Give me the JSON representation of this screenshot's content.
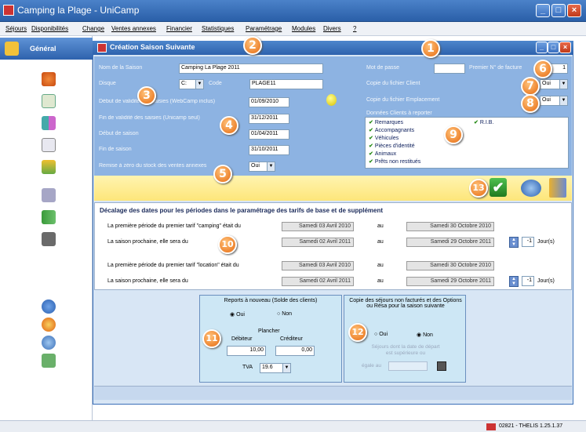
{
  "window": {
    "title": "Camping la Plage - UniCamp"
  },
  "menu": [
    "Séjours",
    "Disponibilités",
    "Change",
    "Ventes annexes",
    "Financier",
    "Statistiques",
    "Paramétrage",
    "Modules",
    "Divers",
    "?"
  ],
  "sidebar": {
    "head": "Général"
  },
  "dialog": {
    "title": "Création Saison Suivante"
  },
  "form": {
    "nom_label": "Nom de la Saison",
    "nom_value": "Camping La Plage 2011",
    "disque_label": "Disque",
    "disque_value": "C:",
    "code_label": "Code",
    "code_value": "PLAGE11",
    "debut_ventes_label": "Début de validité des saisies (WebCamp inclus)",
    "debut_ventes_value": "01/09/2010",
    "fin_ventes_label": "Fin de validité des saisies (Unicamp seul)",
    "fin_ventes_value": "31/12/2011",
    "debut_saison_label": "Début de saison",
    "debut_saison_value": "01/04/2011",
    "fin_saison_label": "Fin de saison",
    "fin_saison_value": "31/10/2011",
    "stock_label": "Remise à zéro du stock des ventes annexes",
    "stock_value": "Oui",
    "mdp_label": "Mot de passe",
    "facture_label": "Premier N° de facture",
    "facture_value": "1",
    "copie_client_label": "Copie du fichier Client",
    "copie_client_value": "Oui",
    "copie_emp_label": "Copie du fichier Emplacement",
    "copie_emp_value": "Oui",
    "donnees_label": "Données Clients à reporter"
  },
  "checks_left": [
    "Remarques",
    "Accompagnants",
    "Véhicules",
    "Pièces d'identité",
    "Animaux",
    "Prêts non restitués"
  ],
  "checks_right": [
    "R.I.B."
  ],
  "decalage": {
    "title": "Décalage des dates pour les périodes dans le paramétrage des tarifs de base et de supplément",
    "r1": "La première période du premier tarif \"camping\" était du",
    "r1a": "Samedi 03 Avril 2010",
    "r1b": "Samedi 30 Octobre 2010",
    "r2": "La saison prochaine, elle sera du",
    "r2a": "Samedi 02 Avril 2011",
    "r2b": "Samedi 29 Octobre 2011",
    "r2n": "-1",
    "jours": "Jour(s)",
    "r3": "La première période du premier tarif \"location\" était du",
    "r3a": "Samedi 03 Avril 2010",
    "r3b": "Samedi 30 Octobre 2010",
    "r4": "La saison prochaine, elle sera du",
    "r4a": "Samedi 02 Avril 2011",
    "r4b": "Samedi 29 Octobre 2011",
    "r4n": "-1",
    "au": "au"
  },
  "reports": {
    "title": "Reports à nouveau (Solde des clients)",
    "oui": "Oui",
    "non": "Non",
    "plancher": "Plancher",
    "debiteur": "Débiteur",
    "crediteur": "Créditeur",
    "deb_value": "10,00",
    "cred_value": "0,00",
    "tva": "TVA",
    "tva_value": "19.6"
  },
  "copie": {
    "title": "Copie des séjours non facturés et des Options ou Résa pour la saison suivante",
    "oui": "Oui",
    "non": "Non",
    "dim1": "Séjours dont la date de départ",
    "dim2": "est supérieure ou",
    "dim3": "égale au"
  },
  "badges": [
    "1",
    "2",
    "3",
    "4",
    "5",
    "6",
    "7",
    "8",
    "9",
    "10",
    "11",
    "12",
    "13"
  ],
  "status": {
    "text": "02821 - THELIS   1.25.1.37"
  }
}
